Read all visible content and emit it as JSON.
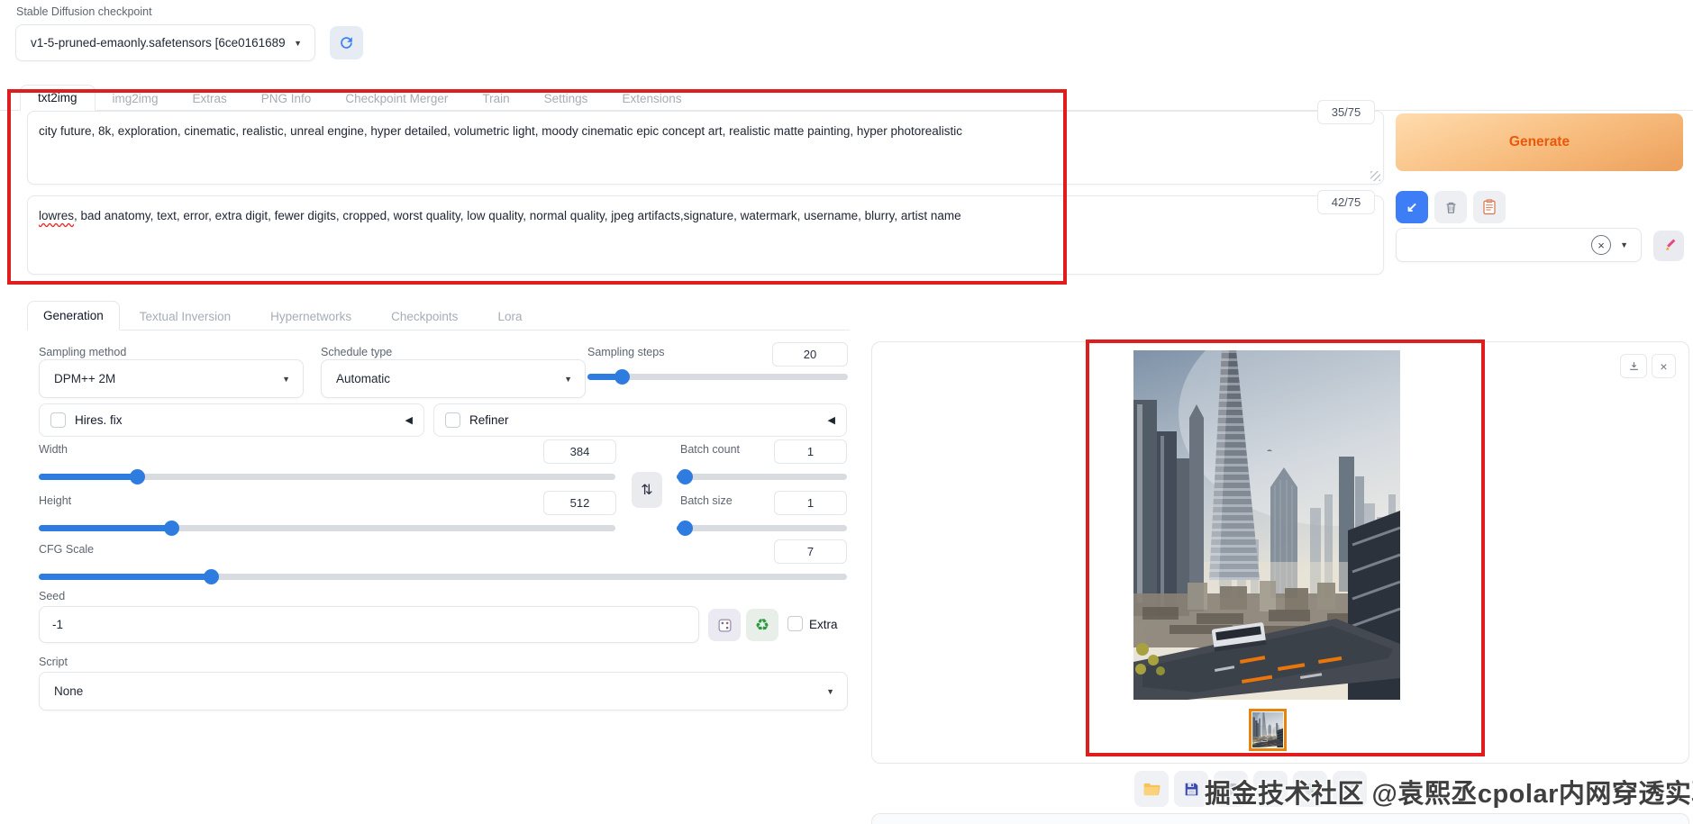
{
  "header": {
    "checkpoint_label": "Stable Diffusion checkpoint",
    "checkpoint_value": "v1-5-pruned-emaonly.safetensors [6ce0161689]"
  },
  "main_tabs": [
    "txt2img",
    "img2img",
    "Extras",
    "PNG Info",
    "Checkpoint Merger",
    "Train",
    "Settings",
    "Extensions"
  ],
  "prompt": {
    "value": "city future, 8k, exploration, cinematic, realistic, unreal engine, hyper detailed, volumetric light, moody cinematic epic concept art, realistic matte painting, hyper photorealistic",
    "counter": "35/75"
  },
  "negative_prompt": {
    "first_word": "lowres",
    "rest": ", bad anatomy, text, error, extra digit, fewer digits, cropped, worst quality, low quality, normal quality, jpeg artifacts,signature, watermark, username, blurry, artist name",
    "counter": "42/75"
  },
  "actions": {
    "generate_label": "Generate"
  },
  "sub_tabs": [
    "Generation",
    "Textual Inversion",
    "Hypernetworks",
    "Checkpoints",
    "Lora"
  ],
  "params": {
    "sampling_method": {
      "label": "Sampling method",
      "value": "DPM++ 2M"
    },
    "schedule_type": {
      "label": "Schedule type",
      "value": "Automatic"
    },
    "sampling_steps": {
      "label": "Sampling steps",
      "value": "20"
    },
    "hires_fix_label": "Hires. fix",
    "refiner_label": "Refiner",
    "width": {
      "label": "Width",
      "value": "384"
    },
    "height": {
      "label": "Height",
      "value": "512"
    },
    "batch_count": {
      "label": "Batch count",
      "value": "1"
    },
    "batch_size": {
      "label": "Batch size",
      "value": "1"
    },
    "cfg_scale": {
      "label": "CFG Scale",
      "value": "7"
    },
    "seed": {
      "label": "Seed",
      "value": "-1",
      "extra_label": "Extra"
    },
    "script": {
      "label": "Script",
      "value": "None"
    }
  },
  "output": {
    "watermark": "掘金技术社区 @袁熙丞cpolar内网穿透实验室"
  },
  "icons": {
    "caret_down": "▼",
    "collapse_left": "◀",
    "swap": "⇅",
    "recycle": "♻",
    "paste_arrow": "↙",
    "close": "×",
    "clear": "×"
  },
  "colors": {
    "accent_blue": "#2f7ce0",
    "generate_text": "#e8590c",
    "generate_gradient_start": "#ffdcae",
    "generate_gradient_end": "#eda05c",
    "annotation_red": "#e01d1d",
    "thumbnail_border": "#e8830d"
  }
}
